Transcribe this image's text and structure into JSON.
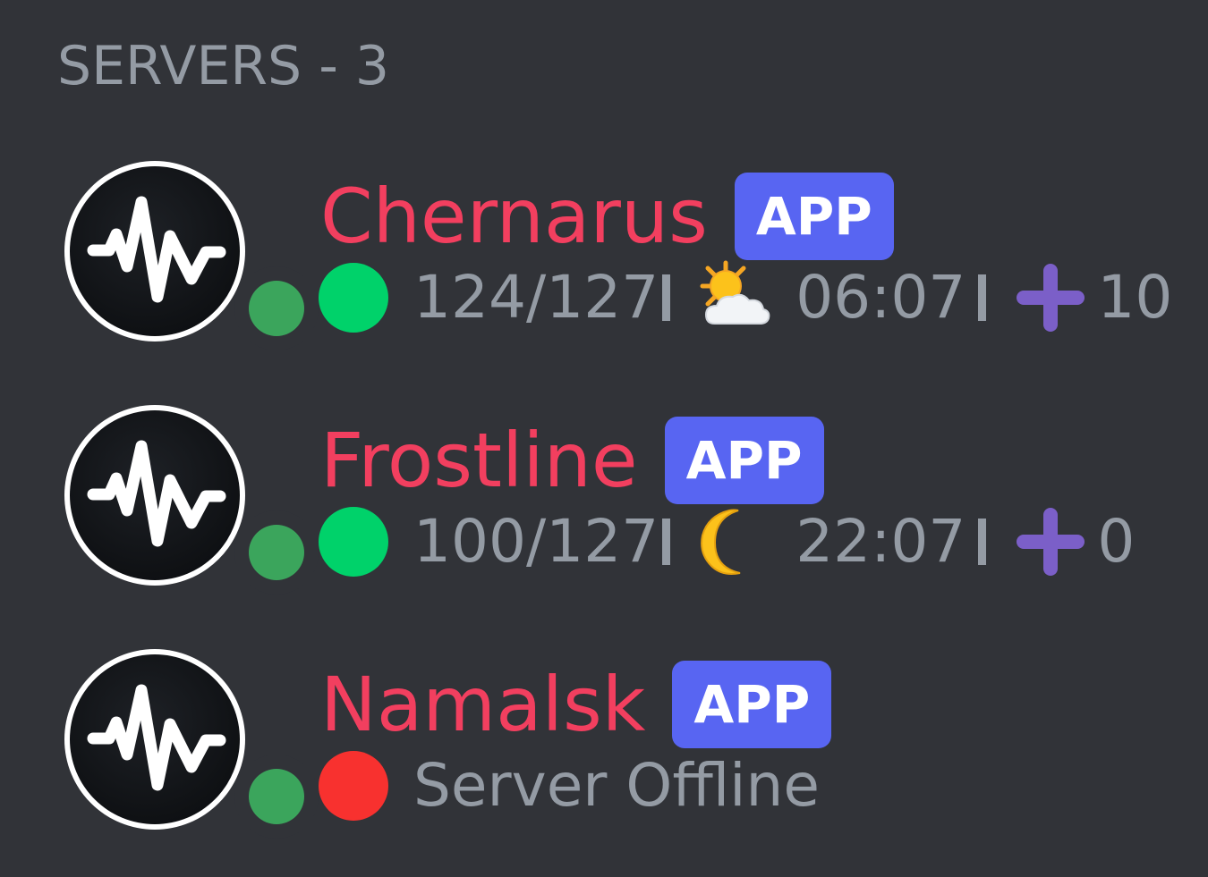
{
  "section": {
    "label": "SERVERS - 3"
  },
  "colors": {
    "background": "#313338",
    "server_name": "#f23f5f",
    "badge": "#5865f2",
    "muted_text": "#949ba4",
    "online": "#00d26a",
    "offline": "#f8312f",
    "avatar_status": "#3ba55c",
    "plus": "#7b5fc8"
  },
  "servers": [
    {
      "name": "Chernarus",
      "badge": "APP",
      "status": "online",
      "players": "124/127",
      "weather_icon": "sun-behind-cloud-icon",
      "time": "06:07",
      "queue": "10"
    },
    {
      "name": "Frostline",
      "badge": "APP",
      "status": "online",
      "players": "100/127",
      "weather_icon": "crescent-moon-icon",
      "time": "22:07",
      "queue": "0"
    },
    {
      "name": "Namalsk",
      "badge": "APP",
      "status": "offline",
      "status_text": "Server Offline"
    }
  ]
}
